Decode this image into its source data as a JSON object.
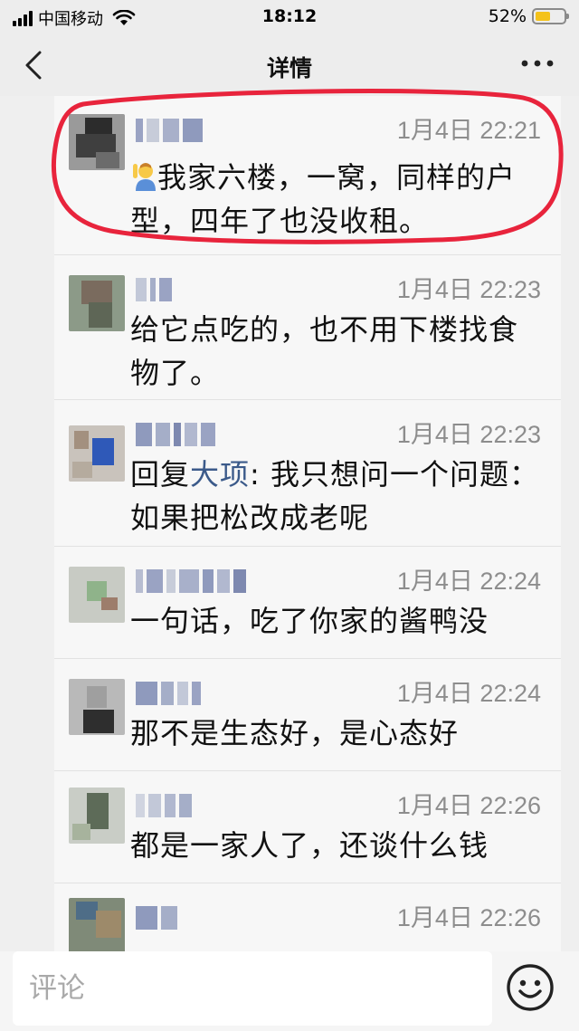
{
  "status_bar": {
    "carrier": "中国移动",
    "time": "18:12",
    "battery_percent_label": "52%",
    "battery_level": 0.52,
    "icons": [
      "signal-icon",
      "wifi-icon",
      "battery-icon"
    ]
  },
  "nav": {
    "title": "详情",
    "back_icon": "chevron-left-icon",
    "more_icon": "more-dots-icon"
  },
  "comments": [
    {
      "time": "1月4日 22:21",
      "emoji": "person-raising-hand-emoji",
      "text": "我家六楼，一窝，同样的户型，四年了也没收租。",
      "highlighted": true
    },
    {
      "time": "1月4日 22:23",
      "text": "给它点吃的，也不用下楼找食物了。"
    },
    {
      "time": "1月4日 22:23",
      "reply_prefix": "回复",
      "reply_to": "大项",
      "text": ": 我只想问一个问题：如果把松改成老呢"
    },
    {
      "time": "1月4日 22:24",
      "text": "一句话，吃了你家的酱鸭没"
    },
    {
      "time": "1月4日 22:24",
      "text": "那不是生态好，是心态好"
    },
    {
      "time": "1月4日 22:26",
      "text": "都是一家人了，还谈什么钱"
    },
    {
      "time": "1月4日 22:26",
      "text": ""
    }
  ],
  "input": {
    "placeholder": "评论",
    "emoji_icon": "smiley-icon"
  },
  "colors": {
    "highlight_ring": "#e8243c",
    "reply_name": "#3b5a8a",
    "battery": "#f4c21a"
  }
}
